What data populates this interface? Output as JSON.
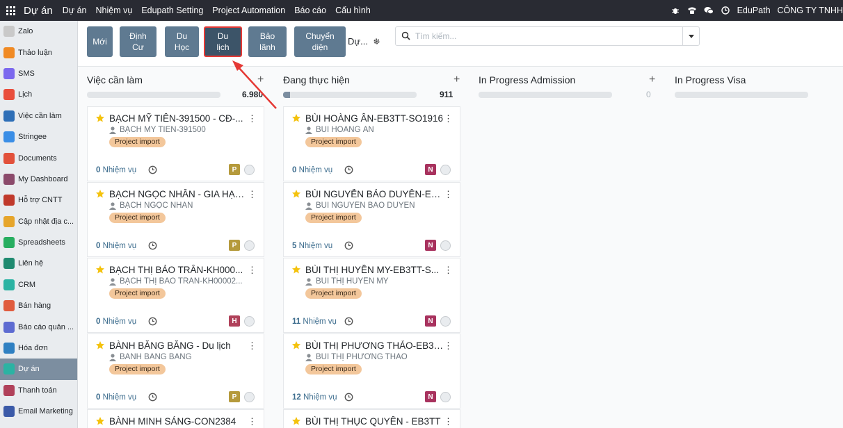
{
  "topbar": {
    "brand": "Dự án",
    "menu": [
      "Dự án",
      "Nhiệm vụ",
      "Edupath Setting",
      "Project Automation",
      "Báo cáo",
      "Cấu hình"
    ],
    "user": "EduPath",
    "company": "CÔNG TY TNHH"
  },
  "sidebar": {
    "items": [
      {
        "label": "Zalo",
        "color": "#c9c9c9"
      },
      {
        "label": "Thảo luận",
        "color": "#f08a24"
      },
      {
        "label": "SMS",
        "color": "#7b68ee"
      },
      {
        "label": "Lịch",
        "color": "#e94e3c"
      },
      {
        "label": "Việc cần làm",
        "color": "#2e6fb7"
      },
      {
        "label": "Stringee",
        "color": "#3a8ee6"
      },
      {
        "label": "Documents",
        "color": "#e2513b"
      },
      {
        "label": "My Dashboard",
        "color": "#8b4a6b"
      },
      {
        "label": "Hỗ trợ CNTT",
        "color": "#c0392b"
      },
      {
        "label": "Cập nhật địa c...",
        "color": "#e6a52b"
      },
      {
        "label": "Spreadsheets",
        "color": "#27ae60"
      },
      {
        "label": "Liên hệ",
        "color": "#1f8a70"
      },
      {
        "label": "CRM",
        "color": "#2bb3a3"
      },
      {
        "label": "Bán hàng",
        "color": "#e05c3e"
      },
      {
        "label": "Báo cáo quản ...",
        "color": "#5d6bd1"
      },
      {
        "label": "Hóa đơn",
        "color": "#2f80c2"
      },
      {
        "label": "Dự án",
        "color": "#2bb3a3"
      },
      {
        "label": "Thanh toán",
        "color": "#b0415a"
      },
      {
        "label": "Email Marketing",
        "color": "#3b5aa8"
      }
    ],
    "active_index": 16
  },
  "control": {
    "buttons": [
      {
        "label": "Mới"
      },
      {
        "label": "Định\nCư"
      },
      {
        "label": "Du\nHọc"
      },
      {
        "label": "Du\nlịch"
      },
      {
        "label": "Bảo\nlãnh"
      },
      {
        "label": "Chuyển\ndiện"
      }
    ],
    "active_index": 3,
    "view_label": "Dự...",
    "search_placeholder": "Tìm kiếm..."
  },
  "columns": [
    {
      "title": "Việc cần làm",
      "count": "6.980",
      "progress": 0.0,
      "cards": [
        {
          "title": "BẠCH MỸ TIÊN-391500 - CĐ-...",
          "customer": "BẠCH MỸ TIÊN-391500",
          "tag": "Project import",
          "tasks_num": "0",
          "tasks_label": "Nhiệm vụ",
          "avatar": "P",
          "avatar_color": "#b59a3c"
        },
        {
          "title": "BẠCH NGỌC NHÂN - GIA HẠN...",
          "customer": "BẠCH NGỌC NHÂN",
          "tag": "Project import",
          "tasks_num": "0",
          "tasks_label": "Nhiệm vụ",
          "avatar": "P",
          "avatar_color": "#b59a3c"
        },
        {
          "title": "BẠCH THỊ BẢO TRÂN-KH000...",
          "customer": "BẠCH THỊ BẢO TRÂN-KH00002...",
          "tag": "Project import",
          "tasks_num": "0",
          "tasks_label": "Nhiệm vụ",
          "avatar": "H",
          "avatar_color": "#b0415a"
        },
        {
          "title": "BÀNH BĂNG BĂNG - Du lịch",
          "customer": "BÀNH BĂNG BĂNG",
          "tag": "Project import",
          "tasks_num": "0",
          "tasks_label": "Nhiệm vụ",
          "avatar": "P",
          "avatar_color": "#b59a3c"
        },
        {
          "title": "BÀNH MINH SÁNG-CON2384",
          "customer": "",
          "tag": "",
          "tasks_num": "",
          "tasks_label": "",
          "avatar": "",
          "avatar_color": "#b59a3c"
        }
      ]
    },
    {
      "title": "Đang thực hiện",
      "count": "911",
      "progress": 0.05,
      "cards": [
        {
          "title": "BÙI HOÀNG ÂN-EB3TT-SO1916",
          "customer": "BÙI HOÀNG ÂN",
          "tag": "Project import",
          "tasks_num": "0",
          "tasks_label": "Nhiệm vụ",
          "avatar": "N",
          "avatar_color": "#a8325e"
        },
        {
          "title": "BÙI NGUYỄN BẢO DUYÊN-EB...",
          "customer": "BÙI NGUYỄN BẢO DUYÊN",
          "tag": "Project import",
          "tasks_num": "5",
          "tasks_label": "Nhiệm vụ",
          "avatar": "N",
          "avatar_color": "#a8325e"
        },
        {
          "title": "BÙI THỊ HUYỀN MY-EB3TT-S...",
          "customer": "BÙI THỊ HUYỀN MY",
          "tag": "Project import",
          "tasks_num": "11",
          "tasks_label": "Nhiệm vụ",
          "avatar": "N",
          "avatar_color": "#a8325e"
        },
        {
          "title": "BÙI THỊ PHƯƠNG THẢO-EB3T...",
          "customer": "BÙI THỊ PHƯƠNG THẢO",
          "tag": "Project import",
          "tasks_num": "12",
          "tasks_label": "Nhiệm vụ",
          "avatar": "N",
          "avatar_color": "#a8325e"
        },
        {
          "title": "BÙI THỊ THỤC QUYÊN - EB3TT",
          "customer": "",
          "tag": "",
          "tasks_num": "",
          "tasks_label": "",
          "avatar": "",
          "avatar_color": "#a8325e"
        }
      ]
    },
    {
      "title": "In Progress Admission",
      "count": "0",
      "progress": 0.0,
      "cards": []
    },
    {
      "title": "In Progress Visa",
      "count": "",
      "progress": 0.0,
      "cards": []
    }
  ],
  "colors": {
    "topbar": "#292b33",
    "filter_button": "#5f7a91",
    "active_button": "#3c5468",
    "highlight": "#e53935",
    "tag": "#f3c79b",
    "star": "#f4c20d"
  }
}
